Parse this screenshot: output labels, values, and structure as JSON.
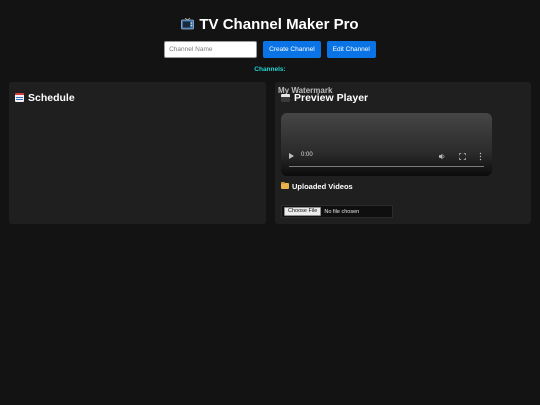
{
  "app": {
    "title": "TV Channel Maker Pro",
    "title_icon": "television-icon"
  },
  "channel_form": {
    "input_placeholder": "Channel Name",
    "input_value": "",
    "create_label": "Create Channel",
    "edit_label": "Edit Channel"
  },
  "channels": {
    "label": "Channels:"
  },
  "schedule": {
    "title": "Schedule",
    "icon": "calendar-icon"
  },
  "preview": {
    "watermark": "My Watermark",
    "title": "Preview Player",
    "icon": "clapper-board-icon",
    "player": {
      "time": "0:00",
      "progress": 0
    }
  },
  "uploads": {
    "title": "Uploaded Videos",
    "icon": "folder-icon",
    "choose_label": "Choose File",
    "status": "No file chosen"
  },
  "colors": {
    "background": "#131313",
    "panel": "#1f1f1f",
    "accent_button": "#0a74e6",
    "channels_label": "#1fd6d6"
  }
}
